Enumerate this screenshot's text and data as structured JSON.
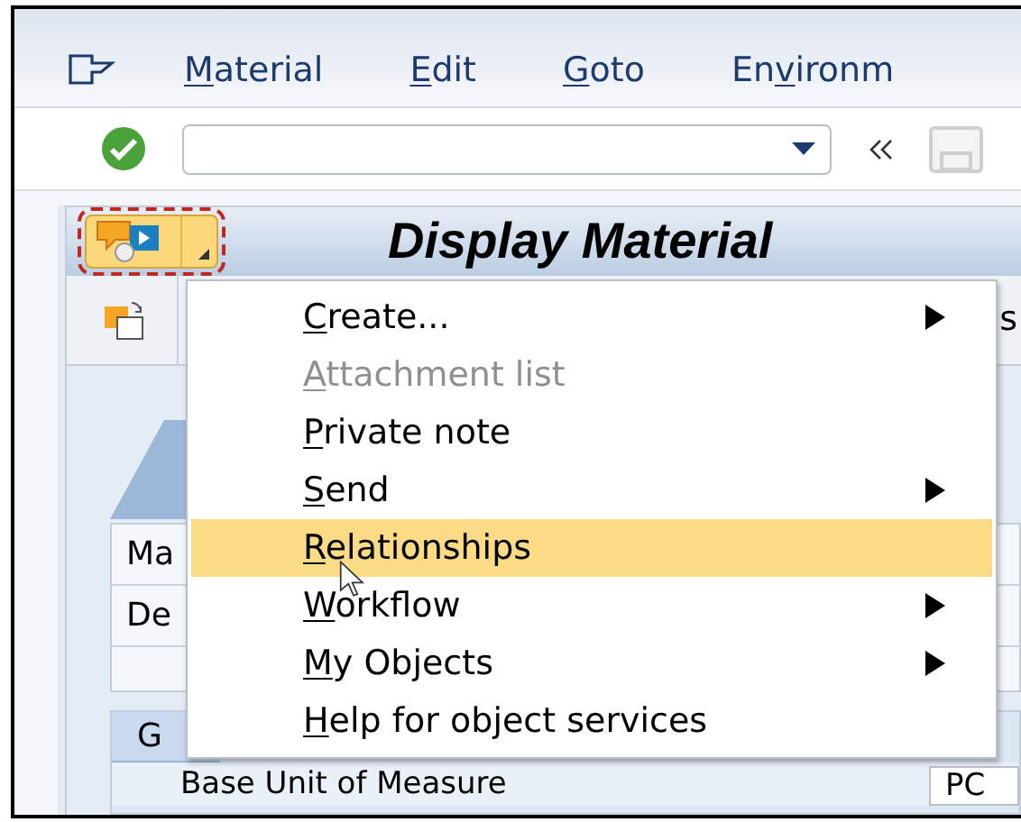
{
  "menu_bar": [
    {
      "key": "M",
      "post": "aterial"
    },
    {
      "key": "E",
      "post": "dit"
    },
    {
      "key": "G",
      "post": "oto"
    },
    {
      "pre": "En",
      "key": "v",
      "post": "ironm"
    }
  ],
  "title": "Display Material",
  "toolbar_text": "s",
  "fields": [
    {
      "label": "Ma"
    },
    {
      "label": "De"
    }
  ],
  "tab": {
    "label": "G",
    "selected": true
  },
  "row_label": "Base Unit of Measure",
  "row_value": "PC",
  "context_menu": [
    {
      "key": "C",
      "post": "reate...",
      "submenu": true,
      "disabled": false,
      "selected": false
    },
    {
      "key": "A",
      "post": "ttachment list",
      "submenu": false,
      "disabled": true,
      "selected": false
    },
    {
      "key": "P",
      "post": "rivate note",
      "submenu": false,
      "disabled": false,
      "selected": false
    },
    {
      "key": "S",
      "post": "end",
      "submenu": true,
      "disabled": false,
      "selected": false
    },
    {
      "key": "R",
      "post": "elationships",
      "submenu": false,
      "disabled": false,
      "selected": true
    },
    {
      "key": "W",
      "post": "orkflow",
      "submenu": true,
      "disabled": false,
      "selected": false
    },
    {
      "key": "M",
      "post": "y Objects",
      "submenu": true,
      "disabled": false,
      "selected": false
    },
    {
      "key": "H",
      "post": "elp for object services",
      "submenu": false,
      "disabled": false,
      "selected": false
    }
  ]
}
